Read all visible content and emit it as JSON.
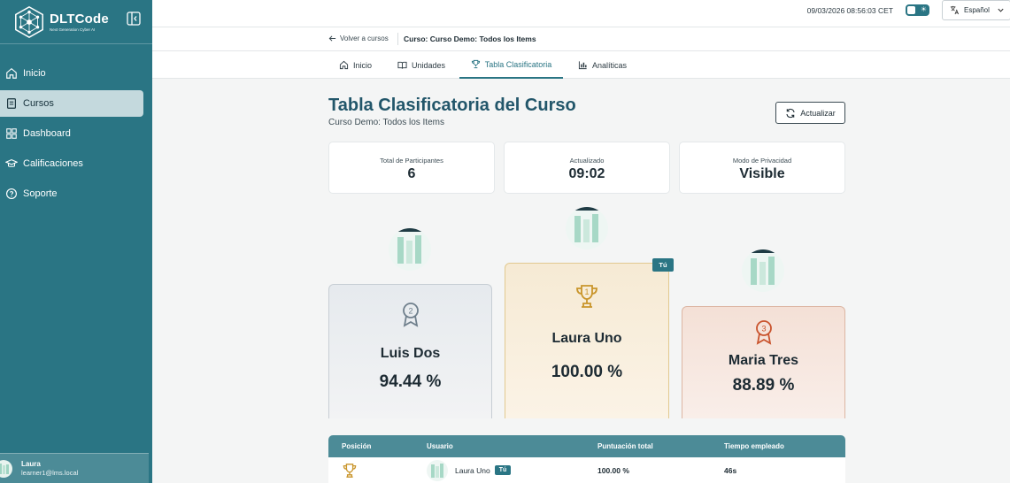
{
  "brand": {
    "name": "DLTCode",
    "tagline": "Next Generation Cyber AI"
  },
  "sidebar": {
    "items": [
      {
        "label": "Inicio",
        "icon": "home-icon"
      },
      {
        "label": "Cursos",
        "icon": "book-icon",
        "active": true
      },
      {
        "label": "Dashboard",
        "icon": "grid-icon"
      },
      {
        "label": "Calificaciones",
        "icon": "graduation-cap-icon"
      },
      {
        "label": "Soporte",
        "icon": "help-circle-icon"
      }
    ],
    "user": {
      "name": "Laura",
      "email": "learner1@lms.local"
    }
  },
  "topbar": {
    "datetime": "09/03/2026 08:56:03 CET",
    "language": "Español"
  },
  "breadcrumb": {
    "back_label": "Volver a cursos",
    "course": "Curso: Curso Demo: Todos los Items"
  },
  "tabs": [
    {
      "label": "Inicio",
      "icon": "home-icon"
    },
    {
      "label": "Unidades",
      "icon": "book-open-icon"
    },
    {
      "label": "Tabla Clasificatoria",
      "icon": "trophy-icon",
      "active": true
    },
    {
      "label": "Analíticas",
      "icon": "bar-chart-icon"
    }
  ],
  "main": {
    "title": "Tabla Clasificatoria del Curso",
    "subtitle": "Curso Demo: Todos los Items",
    "refresh_label": "Actualizar",
    "stats": [
      {
        "label": "Total de Participantes",
        "value": "6"
      },
      {
        "label": "Actualizado",
        "value": "09:02"
      },
      {
        "label": "Modo de Privacidad",
        "value": "Visible"
      }
    ]
  },
  "podium": {
    "first": {
      "name": "Laura Uno",
      "score": "100.00 %",
      "badge": "Tú",
      "rank": "1"
    },
    "second": {
      "name": "Luis Dos",
      "score": "94.44 %",
      "rank": "2"
    },
    "third": {
      "name": "Maria Tres",
      "score": "88.89 %",
      "rank": "3"
    }
  },
  "table": {
    "headers": {
      "position": "Posición",
      "user": "Usuario",
      "score": "Puntuación total",
      "time": "Tiempo empleado"
    },
    "rows": [
      {
        "user": "Laura Uno",
        "badge": "Tú",
        "score": "100.00 %",
        "time": "46s"
      }
    ]
  },
  "colors": {
    "primary": "#2a7584",
    "title": "#22566a",
    "gold": "#c9952b",
    "silver": "#6f7f8c",
    "bronze": "#c9532d"
  }
}
